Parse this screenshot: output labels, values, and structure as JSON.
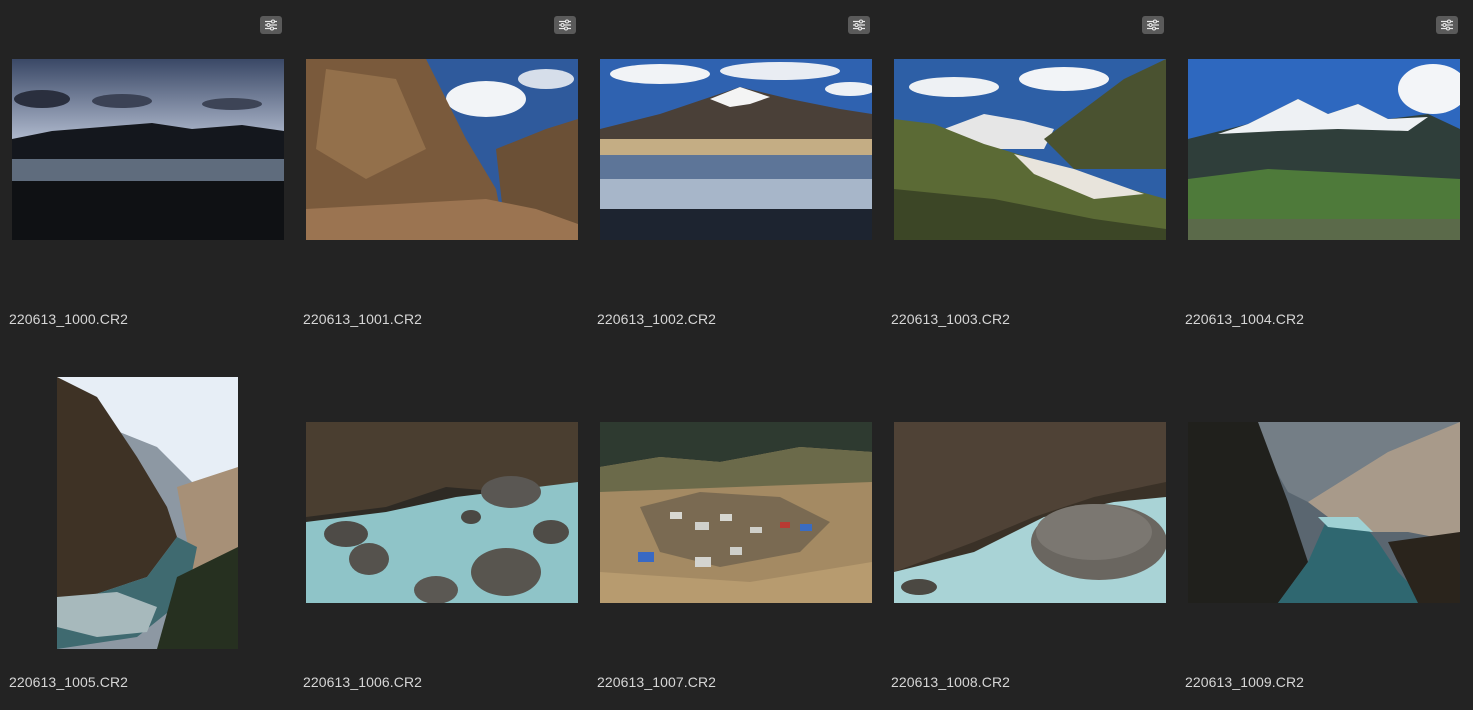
{
  "browser": {
    "items": [
      {
        "filename": "220613_1000.CR2",
        "thumbnail": "lake-at-dusk",
        "adjusted": true
      },
      {
        "filename": "220613_1001.CR2",
        "thumbnail": "canyon-cliff-muddy-river",
        "adjusted": true
      },
      {
        "filename": "220613_1002.CR2",
        "thumbnail": "snow-mountain-lake-reflection",
        "adjusted": true
      },
      {
        "filename": "220613_1003.CR2",
        "thumbnail": "green-valley-snow-peak",
        "adjusted": true
      },
      {
        "filename": "220613_1004.CR2",
        "thumbnail": "snow-peaks-forest",
        "adjusted": true
      },
      {
        "filename": "220613_1005.CR2",
        "thumbnail": "gorge-river-vertical",
        "adjusted": false
      },
      {
        "filename": "220613_1006.CR2",
        "thumbnail": "rapids-boulders",
        "adjusted": false
      },
      {
        "filename": "220613_1007.CR2",
        "thumbnail": "mountain-village",
        "adjusted": false
      },
      {
        "filename": "220613_1008.CR2",
        "thumbnail": "big-rock-rapids",
        "adjusted": false
      },
      {
        "filename": "220613_1009.CR2",
        "thumbnail": "narrow-gorge-river",
        "adjusted": false
      }
    ],
    "adjust_icon": "sliders-icon",
    "colors": {
      "background": "#232323",
      "badge": "#5a5a5a",
      "label": "#d6d6d6"
    }
  }
}
